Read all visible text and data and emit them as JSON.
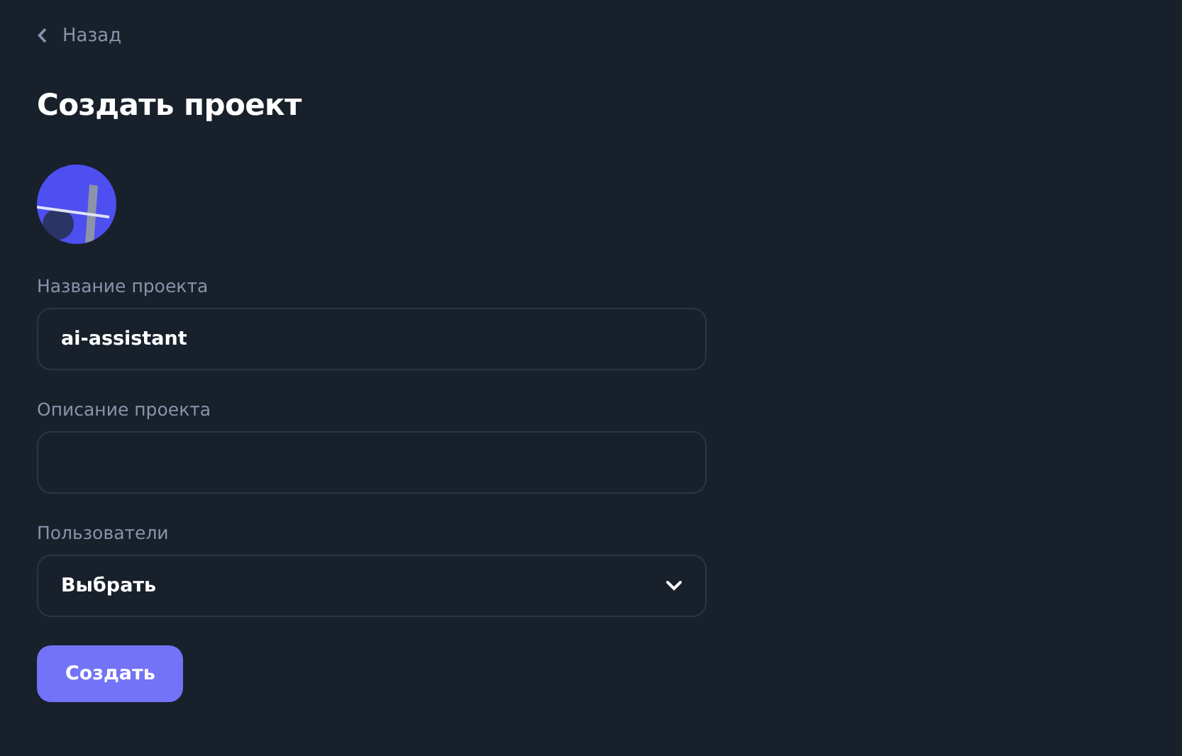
{
  "back_link": {
    "label": "Назад"
  },
  "title": "Создать проект",
  "fields": [
    {
      "kind": "text",
      "label": "Название проекта",
      "value": "ai-assistant"
    },
    {
      "kind": "text",
      "label": "Описание проекта"
    },
    {
      "kind": "select",
      "label": "Пользователи",
      "value": "Выбрать"
    }
  ],
  "submit_button": {
    "label": "Создать"
  }
}
